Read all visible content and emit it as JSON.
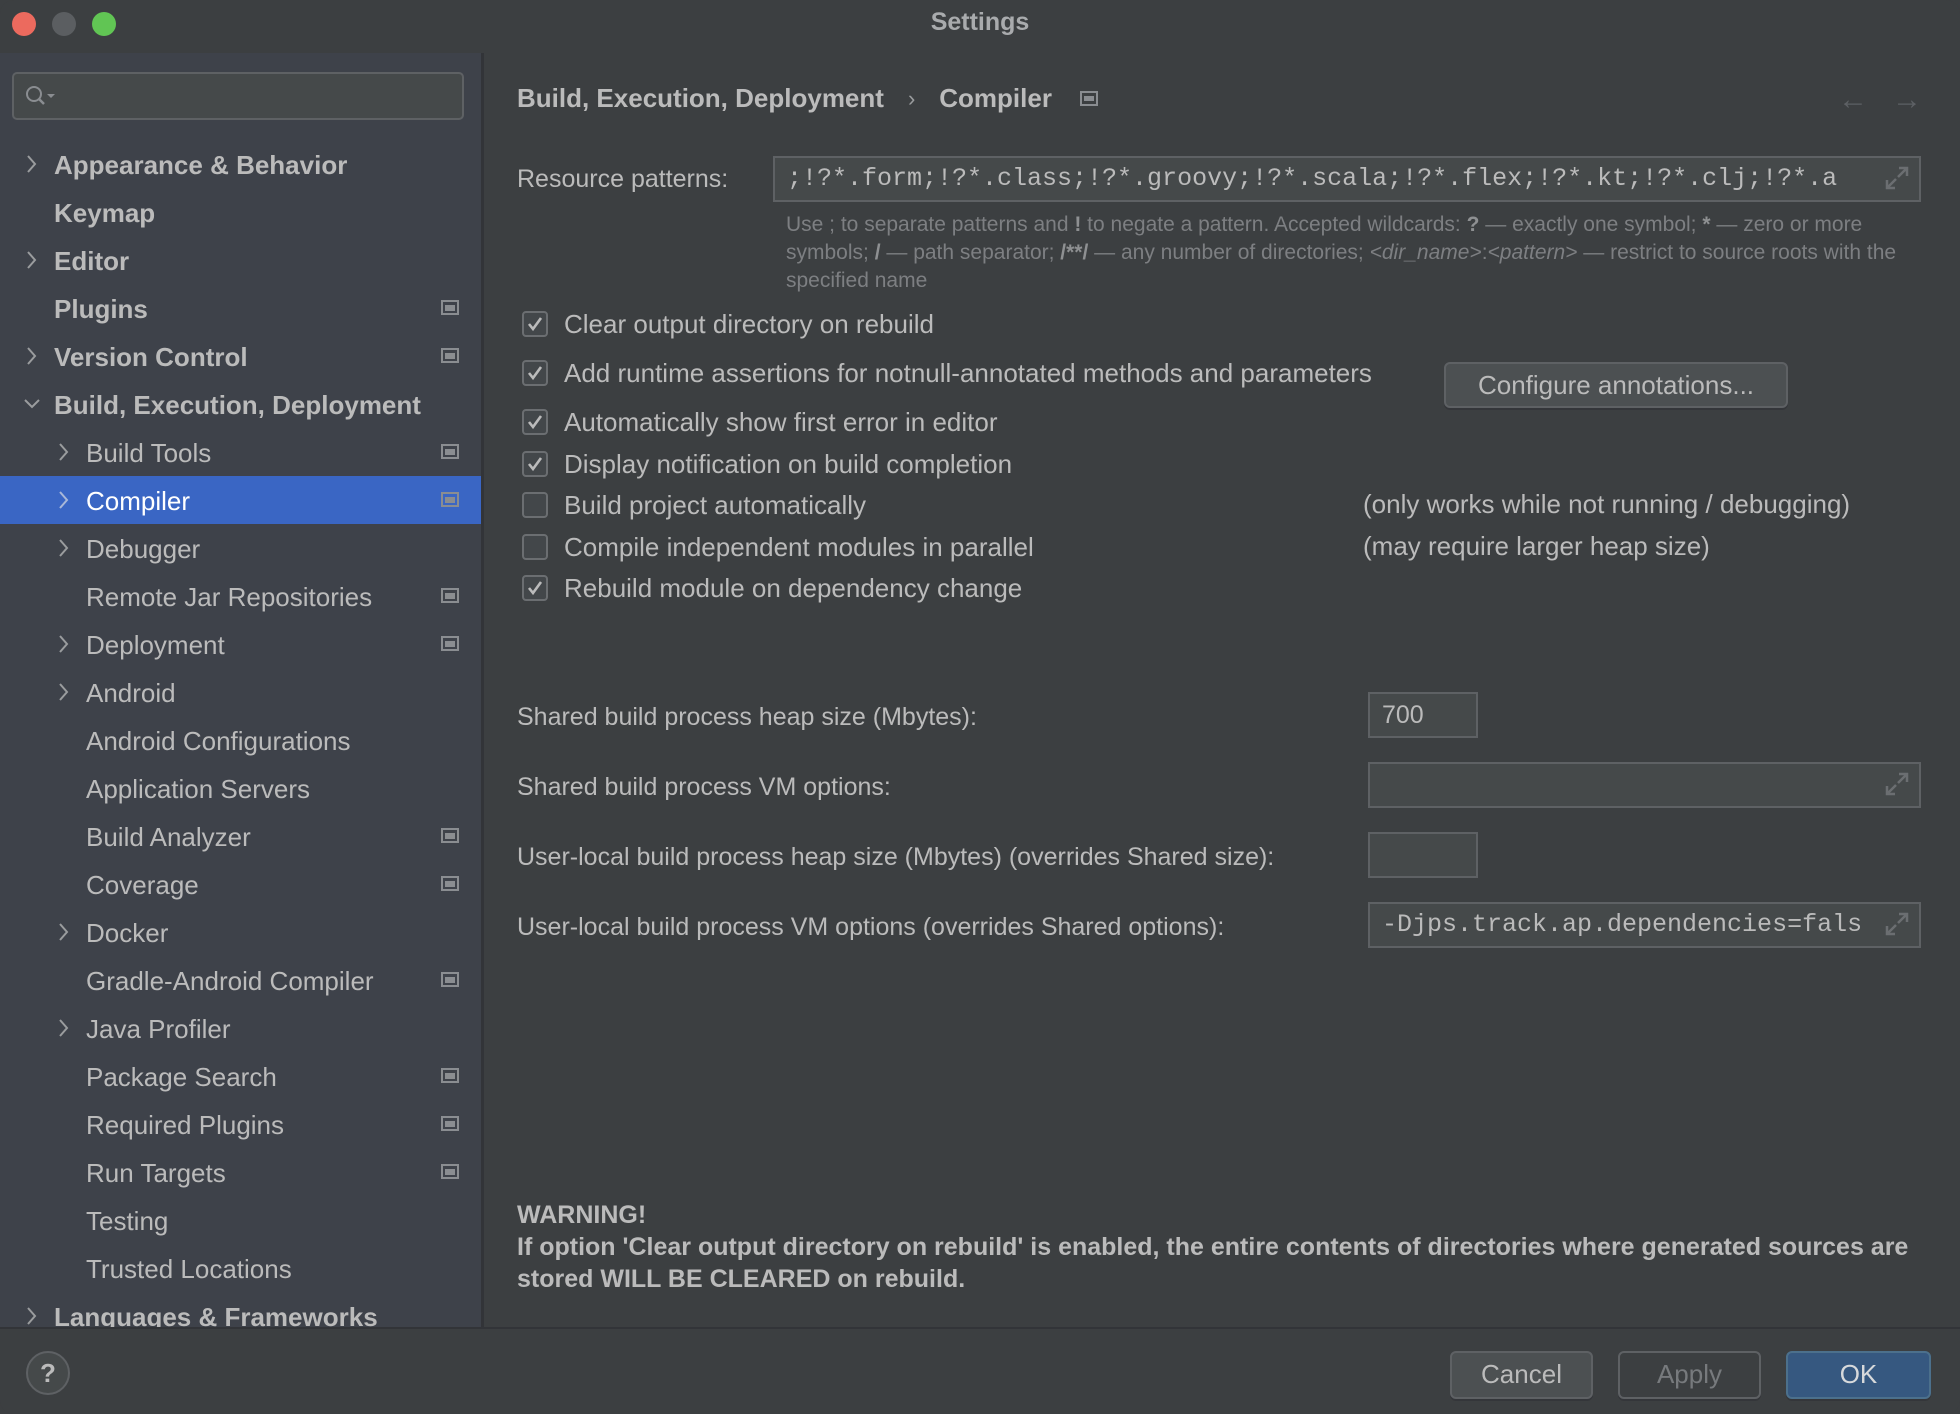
{
  "window": {
    "title": "Settings"
  },
  "sidebar": {
    "search": {
      "value": "",
      "placeholder": ""
    },
    "items": [
      {
        "label": "Appearance & Behavior",
        "level": 0,
        "chevron": "right",
        "project_icon": false,
        "selected": false
      },
      {
        "label": "Keymap",
        "level": 0,
        "chevron": "none",
        "project_icon": false,
        "selected": false
      },
      {
        "label": "Editor",
        "level": 0,
        "chevron": "right",
        "project_icon": false,
        "selected": false
      },
      {
        "label": "Plugins",
        "level": 0,
        "chevron": "none",
        "project_icon": true,
        "selected": false
      },
      {
        "label": "Version Control",
        "level": 0,
        "chevron": "right",
        "project_icon": true,
        "selected": false
      },
      {
        "label": "Build, Execution, Deployment",
        "level": 0,
        "chevron": "down",
        "project_icon": false,
        "selected": false
      },
      {
        "label": "Build Tools",
        "level": 1,
        "chevron": "right",
        "project_icon": true,
        "selected": false
      },
      {
        "label": "Compiler",
        "level": 1,
        "chevron": "right",
        "project_icon": true,
        "selected": true
      },
      {
        "label": "Debugger",
        "level": 1,
        "chevron": "right",
        "project_icon": false,
        "selected": false
      },
      {
        "label": "Remote Jar Repositories",
        "level": 1,
        "chevron": "none",
        "project_icon": true,
        "selected": false
      },
      {
        "label": "Deployment",
        "level": 1,
        "chevron": "right",
        "project_icon": true,
        "selected": false
      },
      {
        "label": "Android",
        "level": 1,
        "chevron": "right",
        "project_icon": false,
        "selected": false
      },
      {
        "label": "Android Configurations",
        "level": 1,
        "chevron": "none",
        "project_icon": false,
        "selected": false
      },
      {
        "label": "Application Servers",
        "level": 1,
        "chevron": "none",
        "project_icon": false,
        "selected": false
      },
      {
        "label": "Build Analyzer",
        "level": 1,
        "chevron": "none",
        "project_icon": true,
        "selected": false
      },
      {
        "label": "Coverage",
        "level": 1,
        "chevron": "none",
        "project_icon": true,
        "selected": false
      },
      {
        "label": "Docker",
        "level": 1,
        "chevron": "right",
        "project_icon": false,
        "selected": false
      },
      {
        "label": "Gradle-Android Compiler",
        "level": 1,
        "chevron": "none",
        "project_icon": true,
        "selected": false
      },
      {
        "label": "Java Profiler",
        "level": 1,
        "chevron": "right",
        "project_icon": false,
        "selected": false
      },
      {
        "label": "Package Search",
        "level": 1,
        "chevron": "none",
        "project_icon": true,
        "selected": false
      },
      {
        "label": "Required Plugins",
        "level": 1,
        "chevron": "none",
        "project_icon": true,
        "selected": false
      },
      {
        "label": "Run Targets",
        "level": 1,
        "chevron": "none",
        "project_icon": true,
        "selected": false
      },
      {
        "label": "Testing",
        "level": 1,
        "chevron": "none",
        "project_icon": false,
        "selected": false
      },
      {
        "label": "Trusted Locations",
        "level": 1,
        "chevron": "none",
        "project_icon": false,
        "selected": false
      },
      {
        "label": "Languages & Frameworks",
        "level": 0,
        "chevron": "right",
        "project_icon": false,
        "selected": false
      }
    ]
  },
  "main": {
    "breadcrumb": {
      "parent": "Build, Execution, Deployment",
      "separator": "›",
      "current": "Compiler"
    },
    "nav": {
      "back": "←",
      "forward": "→"
    },
    "resource_patterns": {
      "label": "Resource patterns:",
      "value": ";!?*.form;!?*.class;!?*.groovy;!?*.scala;!?*.flex;!?*.kt;!?*.clj;!?*.a",
      "hint_parts": {
        "p1": "Use ; to separate patterns and ",
        "b1": "!",
        "p2": " to negate a pattern. Accepted wildcards: ",
        "b2": "?",
        "p3": " — exactly one symbol; ",
        "b3": "*",
        "p4": " — zero or more symbols; ",
        "b4": "/",
        "p5": " — path separator; ",
        "b5": "/**/",
        "p6": " — any number of directories; ",
        "i1": "<dir_name>",
        "p7": ":",
        "i2": "<pattern>",
        "p8": " — restrict to source roots with the specified name"
      }
    },
    "options": [
      {
        "label": "Clear output directory on rebuild",
        "checked": true
      },
      {
        "label": "Add runtime assertions for notnull-annotated methods and parameters",
        "checked": true
      },
      {
        "label": "Automatically show first error in editor",
        "checked": true
      },
      {
        "label": "Display notification on build completion",
        "checked": true
      },
      {
        "label": "Build project automatically",
        "checked": false,
        "note": "(only works while not running / debugging)"
      },
      {
        "label": "Compile independent modules in parallel",
        "checked": false,
        "note": "(may require larger heap size)"
      },
      {
        "label": "Rebuild module on dependency change",
        "checked": true
      }
    ],
    "configure_annotations_label": "Configure annotations...",
    "shared_heap": {
      "label": "Shared build process heap size (Mbytes):",
      "value": "700"
    },
    "shared_vm": {
      "label": "Shared build process VM options:",
      "value": ""
    },
    "user_heap": {
      "label": "User-local build process heap size (Mbytes) (overrides Shared size):",
      "value": ""
    },
    "user_vm": {
      "label": "User-local build process VM options (overrides Shared options):",
      "value": "-Djps.track.ap.dependencies=fals"
    },
    "warning": {
      "title": "WARNING!",
      "text": "If option 'Clear output directory on rebuild' is enabled, the entire contents of directories where generated sources are stored WILL BE CLEARED on rebuild."
    }
  },
  "footer": {
    "help": "?",
    "cancel": "Cancel",
    "apply": "Apply",
    "ok": "OK"
  },
  "colors": {
    "selection": "#3a66c4",
    "primary_button": "#365880",
    "close": "#ec6a5e",
    "minimize": "#5b5e61",
    "maximize": "#61c554"
  }
}
